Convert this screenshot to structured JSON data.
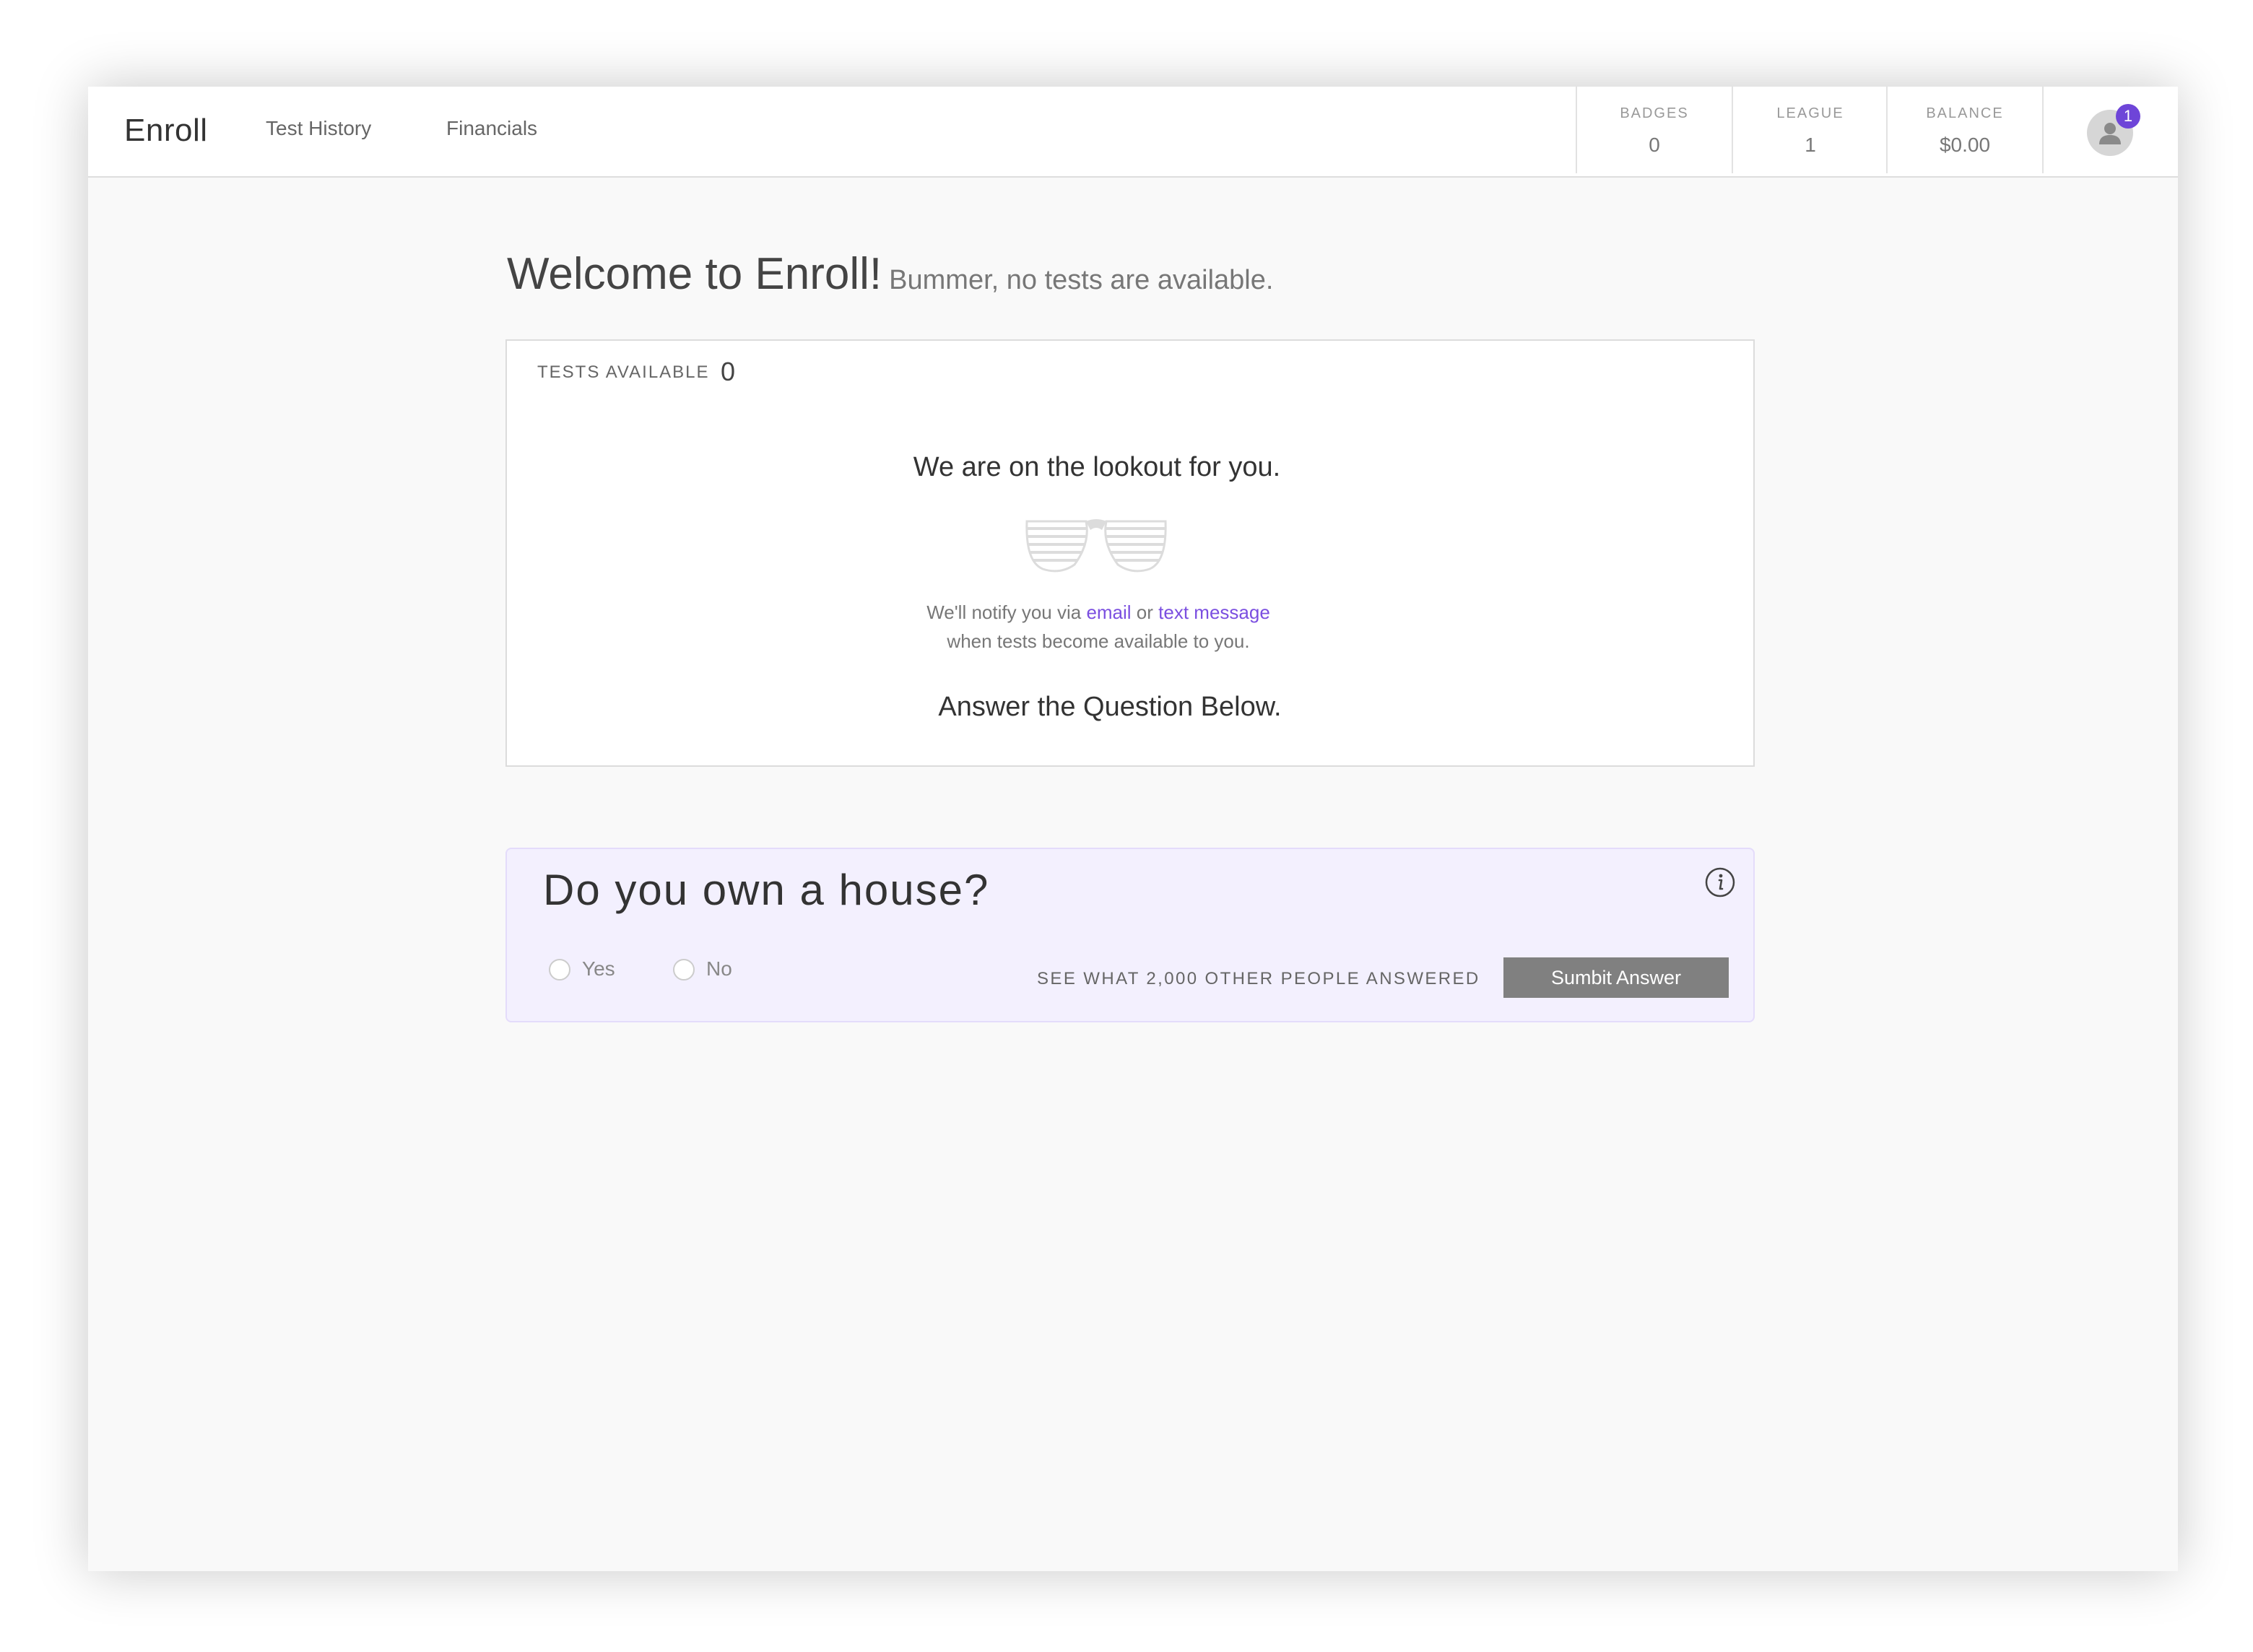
{
  "nav": {
    "brand": "Enroll",
    "links": [
      "Test History",
      "Financials"
    ]
  },
  "stats": {
    "badges": {
      "label": "BADGES",
      "value": "0"
    },
    "league": {
      "label": "LEAGUE",
      "value": "1"
    },
    "balance": {
      "label": "BALANCE",
      "value": "$0.00"
    }
  },
  "profile": {
    "notification_count": "1",
    "icon": "user-avatar-icon"
  },
  "header": {
    "title": "Welcome to Enroll!",
    "subtitle": "Bummer, no tests are available."
  },
  "tests": {
    "label": "TESTS AVAILABLE",
    "count": "0",
    "lookout": "We are on the lookout for you.",
    "icon": "shutter-shades-icon",
    "notify_prefix": "We'll notify you via ",
    "notify_email": "email",
    "notify_or": " or ",
    "notify_text": "text message",
    "notify_suffix": "when tests become available to you.",
    "answer_prompt": "Answer the Question Below."
  },
  "question": {
    "text": "Do you own a house?",
    "options": [
      "Yes",
      "No"
    ],
    "see_others": "SEE WHAT 2,000 OTHER PEOPLE ANSWERED",
    "submit_label": "Sumbit Answer",
    "info_icon": "info-icon"
  },
  "colors": {
    "accent": "#7b4fe0",
    "badge": "#6e45d8",
    "question_bg": "#f3f0fe",
    "button": "#808080"
  }
}
